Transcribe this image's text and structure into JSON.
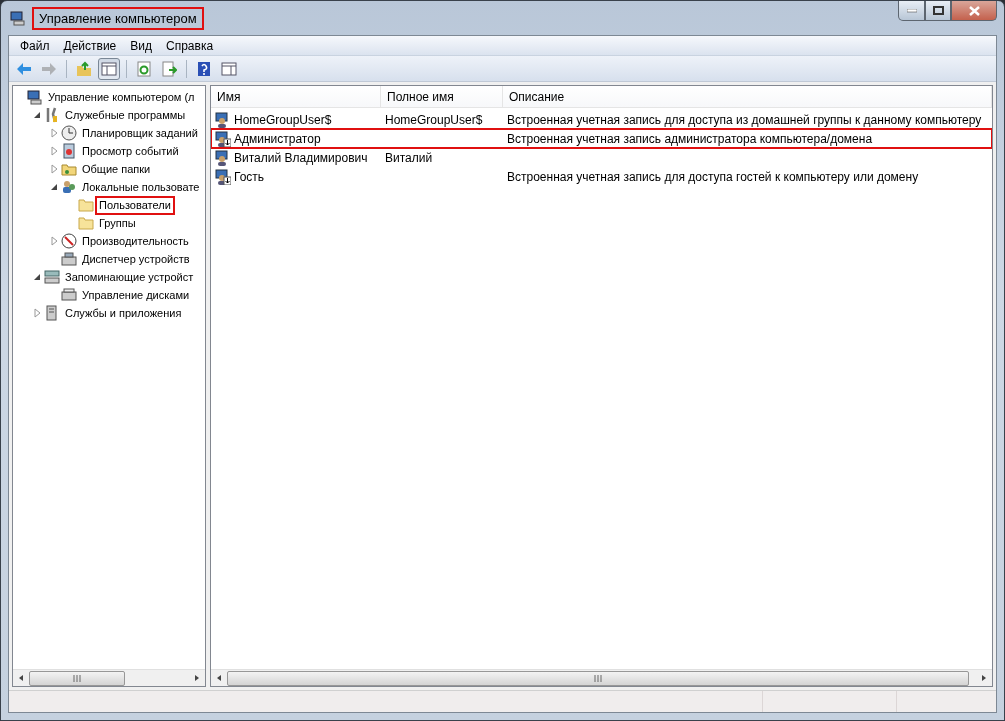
{
  "window": {
    "title": "Управление компьютером",
    "title_highlighted": true
  },
  "menu": [
    "Файл",
    "Действие",
    "Вид",
    "Справка"
  ],
  "toolbar": [
    {
      "kind": "back",
      "disabled": false,
      "pressed": false
    },
    {
      "kind": "forward",
      "disabled": true,
      "pressed": false
    },
    {
      "kind": "separator"
    },
    {
      "kind": "up",
      "disabled": false,
      "pressed": false
    },
    {
      "kind": "tree",
      "disabled": false,
      "pressed": true
    },
    {
      "kind": "separator"
    },
    {
      "kind": "refresh",
      "disabled": false,
      "pressed": false
    },
    {
      "kind": "export",
      "disabled": false,
      "pressed": false
    },
    {
      "kind": "separator"
    },
    {
      "kind": "help",
      "disabled": false,
      "pressed": false
    },
    {
      "kind": "pane",
      "disabled": false,
      "pressed": false
    }
  ],
  "tree": [
    {
      "label": "Управление компьютером (л",
      "kind": "computer",
      "highlighted": false,
      "children": [
        {
          "label": "Служебные программы",
          "kind": "tools",
          "expanded": true,
          "highlighted": false,
          "children": [
            {
              "label": "Планировщик заданий",
              "kind": "clock",
              "expanded": false,
              "highlighted": false
            },
            {
              "label": "Просмотр событий",
              "kind": "events",
              "expanded": false,
              "highlighted": false
            },
            {
              "label": "Общие папки",
              "kind": "shared",
              "expanded": false,
              "highlighted": false
            },
            {
              "label": "Локальные пользовате",
              "kind": "users",
              "expanded": true,
              "highlighted": false,
              "children": [
                {
                  "label": "Пользователи",
                  "kind": "folder",
                  "highlighted": true
                },
                {
                  "label": "Группы",
                  "kind": "folder",
                  "highlighted": false
                }
              ]
            },
            {
              "label": "Производительность",
              "kind": "perf",
              "expanded": false,
              "highlighted": false
            },
            {
              "label": "Диспетчер устройств",
              "kind": "devices",
              "highlighted": false
            }
          ]
        },
        {
          "label": "Запоминающие устройст",
          "kind": "storage",
          "expanded": true,
          "highlighted": false,
          "children": [
            {
              "label": "Управление дисками",
              "kind": "disk",
              "highlighted": false
            }
          ]
        },
        {
          "label": "Службы и приложения",
          "kind": "services",
          "expanded": false,
          "highlighted": false
        }
      ]
    }
  ],
  "table": {
    "columns": [
      "Имя",
      "Полное имя",
      "Описание"
    ],
    "rows": [
      {
        "name": "HomeGroupUser$",
        "full_name": "HomeGroupUser$",
        "description": "Встроенная учетная запись для доступа из домашней группы к данному компьютеру",
        "disabled": false,
        "highlighted": false
      },
      {
        "name": "Администратор",
        "description": "Встроенная учетная запись администратора компьютера/домена",
        "disabled": true,
        "highlighted": true
      },
      {
        "name": "Виталий Владимирович",
        "full_name": "Виталий",
        "disabled": false,
        "highlighted": false
      },
      {
        "name": "Гость",
        "description": "Встроенная учетная запись для доступа гостей к компьютеру или домену",
        "disabled": true,
        "highlighted": false
      }
    ]
  }
}
